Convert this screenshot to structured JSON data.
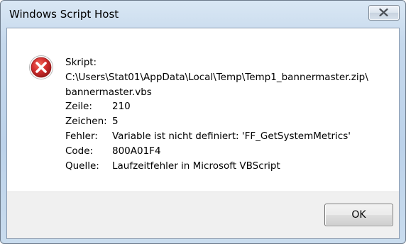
{
  "window": {
    "title": "Windows Script Host"
  },
  "icons": {
    "error": "error-icon",
    "close": "close-icon"
  },
  "message": {
    "skript_label": "Skript:",
    "path_line1": "C:\\Users\\Stat01\\AppData\\Local\\Temp\\Temp1_bannermaster.zip\\",
    "path_line2": "bannermaster.vbs",
    "fields": [
      {
        "label": "Zeile:",
        "value": "210"
      },
      {
        "label": "Zeichen:",
        "value": "5"
      },
      {
        "label": "Fehler:",
        "value": "Variable ist nicht definiert: 'FF_GetSystemMetrics'"
      },
      {
        "label": "Code:",
        "value": "800A01F4"
      },
      {
        "label": "Quelle:",
        "value": "Laufzeitfehler in Microsoft VBScript"
      }
    ]
  },
  "buttons": {
    "ok": "OK"
  },
  "colors": {
    "error_red": "#c62828",
    "frame_blue": "#c5d8ec"
  }
}
